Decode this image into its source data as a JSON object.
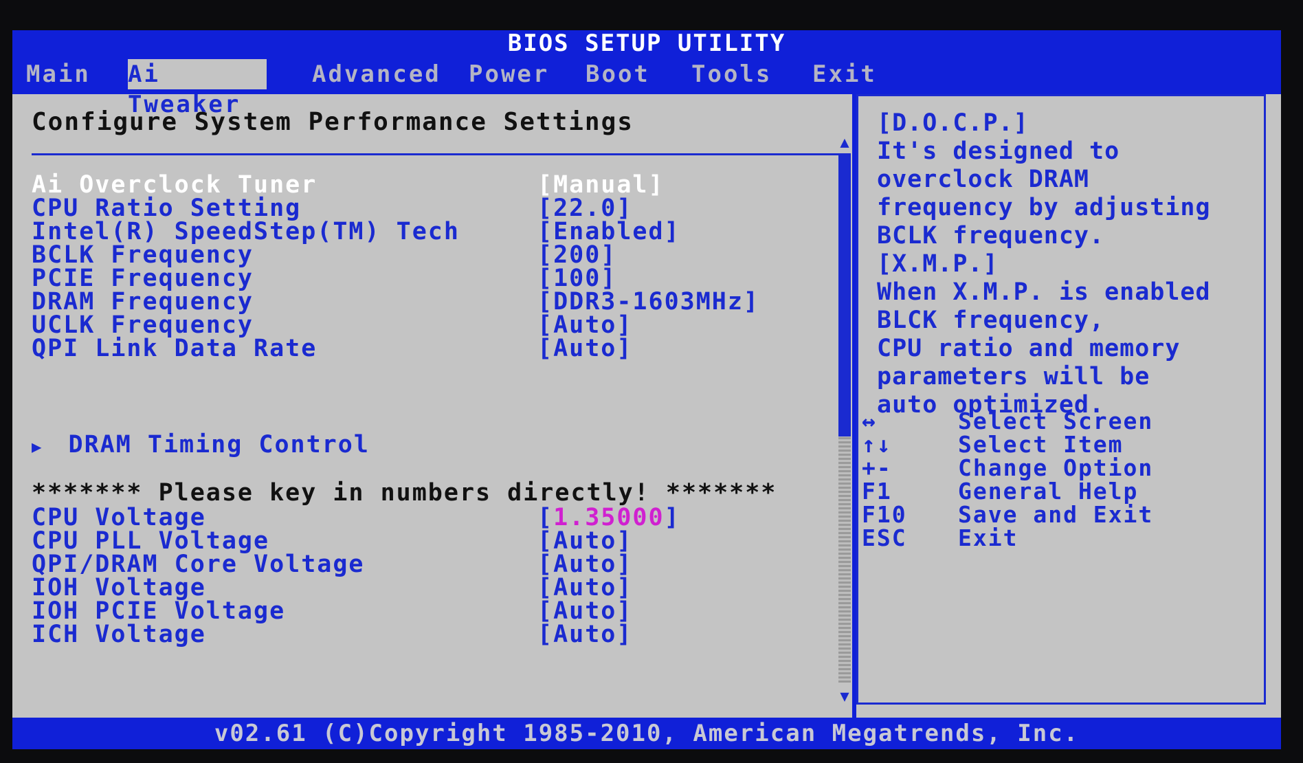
{
  "window": {
    "title": "BIOS SETUP UTILITY"
  },
  "menu": {
    "tabs": [
      {
        "label": "Main"
      },
      {
        "label": "Ai Tweaker",
        "active": true
      },
      {
        "label": "Advanced"
      },
      {
        "label": "Power"
      },
      {
        "label": "Boot"
      },
      {
        "label": "Tools"
      },
      {
        "label": "Exit"
      }
    ]
  },
  "main": {
    "section_title": "Configure System Performance Settings",
    "settings": [
      {
        "label": "Ai Overclock Tuner",
        "value": "[Manual]"
      },
      {
        "label": "CPU Ratio Setting",
        "value": "[22.0]"
      },
      {
        "label": "Intel(R) SpeedStep(TM) Tech",
        "value": "[Enabled]"
      },
      {
        "label": "BCLK Frequency",
        "value": "[200]"
      },
      {
        "label": "PCIE Frequency",
        "value": "[100]"
      },
      {
        "label": "DRAM Frequency",
        "value": "[DDR3-1603MHz]"
      },
      {
        "label": "UCLK Frequency",
        "value": "[Auto]"
      },
      {
        "label": "QPI Link Data Rate",
        "value": "[Auto]"
      }
    ],
    "submenu": {
      "arrow": "▶",
      "label": "DRAM Timing Control"
    },
    "notice": "******* Please key in numbers directly! *******",
    "voltages": [
      {
        "label": "CPU Voltage",
        "value_prefix": "[",
        "value_highlight": "1.35000",
        "value_suffix": "]"
      },
      {
        "label": "CPU PLL Voltage",
        "value": "[Auto]"
      },
      {
        "label": "QPI/DRAM Core Voltage",
        "value": "[Auto]"
      },
      {
        "label": "IOH Voltage",
        "value": "[Auto]"
      },
      {
        "label": "IOH PCIE Voltage",
        "value": "[Auto]"
      },
      {
        "label": "ICH Voltage",
        "value": "[Auto]"
      }
    ]
  },
  "help": {
    "text": "[D.O.C.P.]\nIt's designed to\noverclock DRAM\nfrequency by adjusting\nBCLK frequency.\n[X.M.P.]\nWhen X.M.P. is enabled\nBLCK frequency,\nCPU ratio and memory\nparameters will be\nauto optimized.",
    "keys": [
      {
        "key": "↔",
        "desc": "Select Screen"
      },
      {
        "key": "↑↓",
        "desc": "Select Item"
      },
      {
        "key": "+-",
        "desc": "Change Option"
      },
      {
        "key": "F1",
        "desc": "General Help"
      },
      {
        "key": "F10",
        "desc": "Save and Exit"
      },
      {
        "key": "ESC",
        "desc": "Exit"
      }
    ]
  },
  "footer": {
    "text": "v02.61 (C)Copyright 1985-2010, American Megatrends, Inc."
  },
  "colors": {
    "bios_blue": "#1020d8",
    "panel_gray": "#c4c4c4",
    "text_blue": "#1a2ad0",
    "highlight_pink": "#d020d0"
  }
}
